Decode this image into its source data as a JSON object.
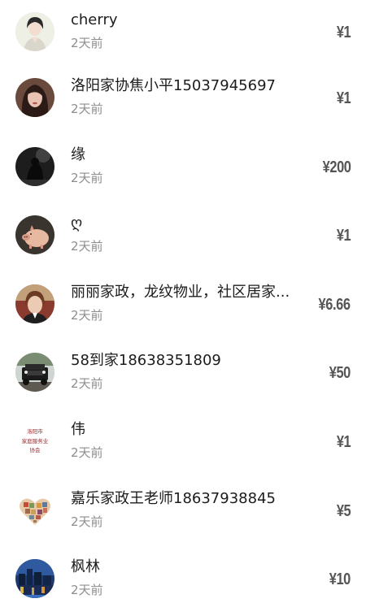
{
  "donations": [
    {
      "name": "cherry",
      "time": "2天前",
      "amount": "¥1",
      "avatar_icon": "woman-illustration-avatar"
    },
    {
      "name": "洛阳家协焦小平15037945697",
      "time": "2天前",
      "amount": "¥1",
      "avatar_icon": "woman-photo-avatar"
    },
    {
      "name": "缘",
      "time": "2天前",
      "amount": "¥200",
      "avatar_icon": "dark-silhouette-avatar"
    },
    {
      "name": "ღ",
      "time": "2天前",
      "amount": "¥1",
      "avatar_icon": "pig-avatar"
    },
    {
      "name": "丽丽家政，龙纹物业，社区居家...",
      "time": "2天前",
      "amount": "¥6.66",
      "avatar_icon": "woman-portrait-avatar"
    },
    {
      "name": "58到家18638351809",
      "time": "2天前",
      "amount": "¥50",
      "avatar_icon": "jeep-avatar"
    },
    {
      "name": "伟",
      "time": "2天前",
      "amount": "¥1",
      "avatar_icon": "association-logo-avatar",
      "avatar_text": [
        "洛阳市",
        "家庭服务业",
        "协会"
      ]
    },
    {
      "name": "嘉乐家政王老师18637938845",
      "time": "2天前",
      "amount": "¥5",
      "avatar_icon": "heart-collage-avatar"
    },
    {
      "name": "枫林",
      "time": "2天前",
      "amount": "¥10",
      "avatar_icon": "night-city-avatar"
    }
  ],
  "colors": {
    "name": "#1c1c1c",
    "time": "#8e8e8e",
    "amount": "#555555",
    "logo_red": "#9b2b2b"
  }
}
